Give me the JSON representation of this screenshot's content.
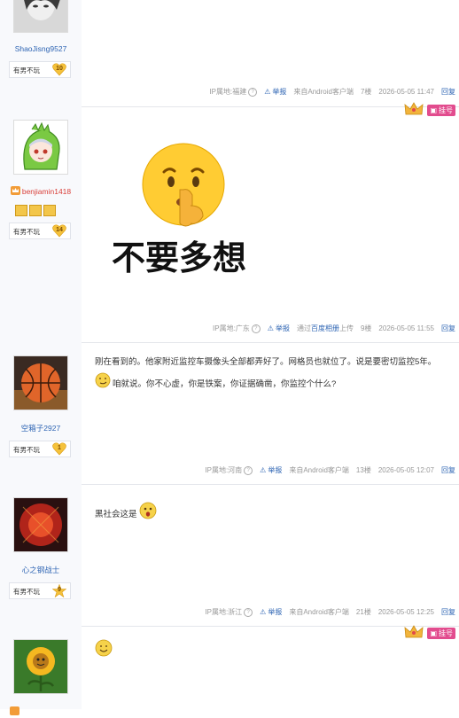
{
  "posts": [
    {
      "username": "ShaoJisng9527",
      "badge_text": "有男不玩",
      "badge_level": "10",
      "footer": {
        "ip": "IP属地:福建",
        "report": "举报",
        "source": "来自Android客户端",
        "floor": "7楼",
        "time": "2026-05-05 11:47",
        "reply": "回复"
      }
    },
    {
      "username": "benjiamin1418",
      "badge_text": "有男不玩",
      "badge_level": "14",
      "sticker_text": "不要多想",
      "top_button": "挂号",
      "footer": {
        "ip": "IP属地:广东",
        "report": "举报",
        "source_prefix": "通过",
        "source_link": "百度相册",
        "source_suffix": "上传",
        "floor": "9楼",
        "time": "2026-05-05 11:55",
        "reply": "回复"
      }
    },
    {
      "username": "空箱子2927",
      "badge_text": "有男不玩",
      "badge_level": "1",
      "content_line1": "刚在看到的。他家附近监控车摄像头全部都弄好了。网格员也就位了。说是要密切监控5年。",
      "content_line2": "咱就说。你不心虚，你是铁案，你证据确凿，你监控个什么?",
      "footer": {
        "ip": "IP属地:河南",
        "report": "举报",
        "source": "来自Android客户端",
        "floor": "13楼",
        "time": "2026-05-05 12:07",
        "reply": "回复"
      }
    },
    {
      "username": "心之钢战士",
      "badge_text": "有男不玩",
      "badge_level": "9",
      "content": "黑社会这是",
      "footer": {
        "ip": "IP属地:浙江",
        "report": "举报",
        "source": "来自Android客户端",
        "floor": "21楼",
        "time": "2026-05-05 12:25",
        "reply": "回复"
      }
    },
    {
      "top_button": "挂号"
    }
  ],
  "colors": {
    "link": "#2d64b3",
    "meta": "#999999",
    "sidebar_bg": "#f8f9fc",
    "report_btn": "#e24c8e"
  }
}
